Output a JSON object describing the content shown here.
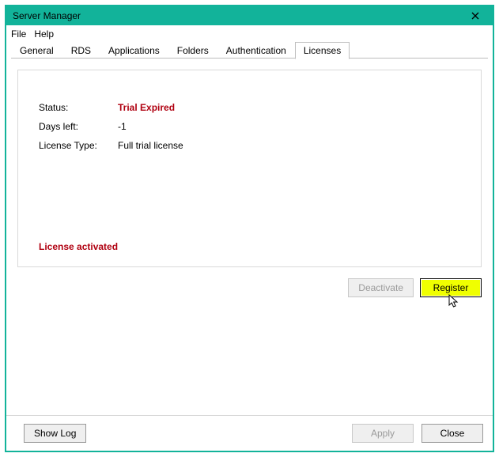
{
  "window": {
    "title": "Server Manager"
  },
  "menu": {
    "file": "File",
    "help": "Help"
  },
  "tabs": {
    "general": "General",
    "rds": "RDS",
    "applications": "Applications",
    "folders": "Folders",
    "authentication": "Authentication",
    "licenses": "Licenses"
  },
  "license": {
    "status_label": "Status:",
    "status_value": "Trial Expired",
    "days_left_label": "Days left:",
    "days_left_value": "-1",
    "type_label": "License Type:",
    "type_value": "Full trial license",
    "activated_text": "License activated"
  },
  "buttons": {
    "deactivate": "Deactivate",
    "register": "Register",
    "show_log": "Show Log",
    "apply": "Apply",
    "close": "Close"
  }
}
